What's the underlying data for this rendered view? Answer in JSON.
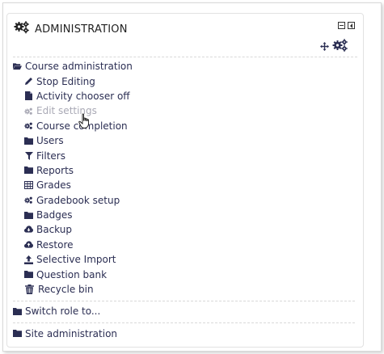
{
  "block": {
    "title": "ADMINISTRATION",
    "move_icon": "move-icon",
    "config_icon": "gears-icon"
  },
  "tree": {
    "course_admin": {
      "label": "Course administration",
      "items": [
        {
          "label": "Stop Editing",
          "icon": "pencil-icon",
          "muted": false
        },
        {
          "label": "Activity chooser off",
          "icon": "file-icon",
          "muted": false
        },
        {
          "label": "Edit settings",
          "icon": "gears-icon",
          "muted": true
        },
        {
          "label": "Course completion",
          "icon": "gears-icon",
          "muted": false
        },
        {
          "label": "Users",
          "icon": "folder-icon",
          "muted": false
        },
        {
          "label": "Filters",
          "icon": "filter-icon",
          "muted": false
        },
        {
          "label": "Reports",
          "icon": "folder-icon",
          "muted": false
        },
        {
          "label": "Grades",
          "icon": "table-icon",
          "muted": false
        },
        {
          "label": "Gradebook setup",
          "icon": "gears-icon",
          "muted": false
        },
        {
          "label": "Badges",
          "icon": "folder-icon",
          "muted": false
        },
        {
          "label": "Backup",
          "icon": "cloud-download-icon",
          "muted": false
        },
        {
          "label": "Restore",
          "icon": "cloud-upload-icon",
          "muted": false
        },
        {
          "label": "Selective Import",
          "icon": "upload-icon",
          "muted": false
        },
        {
          "label": "Question bank",
          "icon": "folder-icon",
          "muted": false
        },
        {
          "label": "Recycle bin",
          "icon": "trash-icon",
          "muted": false
        }
      ]
    },
    "switch_role": {
      "label": "Switch role to..."
    },
    "site_admin": {
      "label": "Site administration"
    }
  },
  "colors": {
    "link": "#2b2e53",
    "muted": "#a9a9b5"
  }
}
